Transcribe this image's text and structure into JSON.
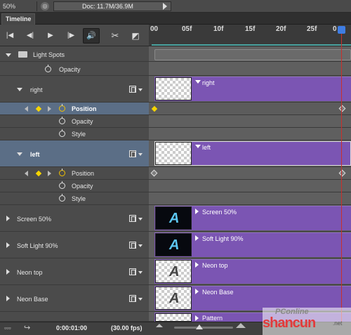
{
  "status": {
    "zoom": "50%",
    "doc": "Doc: 11.7M/36.9M"
  },
  "panel": {
    "tab": "Timeline"
  },
  "ruler": {
    "ticks": [
      "00",
      "05f",
      "10f",
      "15f",
      "20f",
      "25f",
      "0"
    ]
  },
  "layers": {
    "group": "Light Spots",
    "group_opacity": "Opacity",
    "right": {
      "name": "right",
      "props": [
        "Position",
        "Opacity",
        "Style"
      ]
    },
    "left": {
      "name": "left",
      "props": [
        "Position",
        "Opacity",
        "Style"
      ]
    },
    "others": [
      "Screen 50%",
      "Soft Light 90%",
      "Neon top",
      "Neon Base"
    ]
  },
  "clips": {
    "right": "right",
    "left": "left",
    "screen": "Screen 50%",
    "soft": "Soft Light 90%",
    "neontop": "Neon top",
    "neonbase": "Neon Base",
    "pattern": "Pattern"
  },
  "footer": {
    "timecode": "0:00:01:00",
    "fps": "(30.00 fps)"
  },
  "watermark": {
    "line1": "PConline",
    "line2": "shancun",
    "line3": ".net"
  },
  "colors": {
    "clip": "#7b55b3",
    "playhead": "#c9302c",
    "selected_row": "#5b6e86",
    "keyframe": "#f5d400"
  }
}
